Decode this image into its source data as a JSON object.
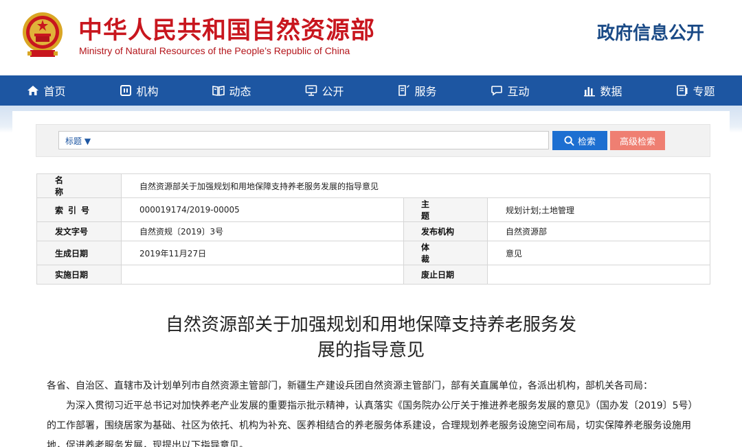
{
  "header": {
    "title_cn": "中华人民共和国自然资源部",
    "title_en": "Ministry of Natural Resources of the People’s Republic of China",
    "right_label": "政府信息公开"
  },
  "nav": {
    "items": [
      {
        "label": "首页",
        "icon": "home-icon"
      },
      {
        "label": "机构",
        "icon": "org-icon"
      },
      {
        "label": "动态",
        "icon": "news-icon"
      },
      {
        "label": "公开",
        "icon": "disclosure-icon"
      },
      {
        "label": "服务",
        "icon": "service-icon"
      },
      {
        "label": "互动",
        "icon": "chat-icon"
      },
      {
        "label": "数据",
        "icon": "chart-icon"
      },
      {
        "label": "专题",
        "icon": "topic-icon"
      }
    ]
  },
  "search": {
    "select_label": "标题 ▼",
    "input_value": "",
    "search_button": "检索",
    "advanced_button": "高级检索"
  },
  "info": {
    "name_label": "名　称",
    "name_value": "自然资源部关于加强规划和用地保障支持养老服务发展的指导意见",
    "index_label": "索引号",
    "index_value": "000019174/2019-00005",
    "topic_label": "主　题",
    "topic_value": "规划计划;土地管理",
    "doc_no_label": "发文字号",
    "doc_no_value": "自然资规〔2019〕3号",
    "issuer_label": "发布机构",
    "issuer_value": "自然资源部",
    "date_label": "生成日期",
    "date_value": "2019年11月27日",
    "genre_label": "体　裁",
    "genre_value": "意见",
    "effective_label": "实施日期",
    "effective_value": "",
    "repeal_label": "废止日期",
    "repeal_value": ""
  },
  "doc": {
    "title_line1": "自然资源部关于加强规划和用地保障支持养老服务发",
    "title_line2": "展的指导意见",
    "addressee": "各省、自治区、直辖市及计划单列市自然资源主管部门，新疆生产建设兵团自然资源主管部门，部有关直属单位，各派出机构，部机关各司局：",
    "paragraph1": "为深入贯彻习近平总书记对加快养老产业发展的重要指示批示精神，认真落实《国务院办公厅关于推进养老服务发展的意见》（国办发〔2019〕5号）的工作部署，围绕居家为基础、社区为依托、机构为补充、医养相结合的养老服务体系建设，合理规划养老服务设施空间布局，切实保障养老服务设施用地，促进养老服务发展，现提出以下指导意见。"
  },
  "colors": {
    "brand_red": "#c8161e",
    "nav_blue": "#1d56a2",
    "search_blue": "#1d6fd1",
    "advanced_salmon": "#ef7f72"
  }
}
